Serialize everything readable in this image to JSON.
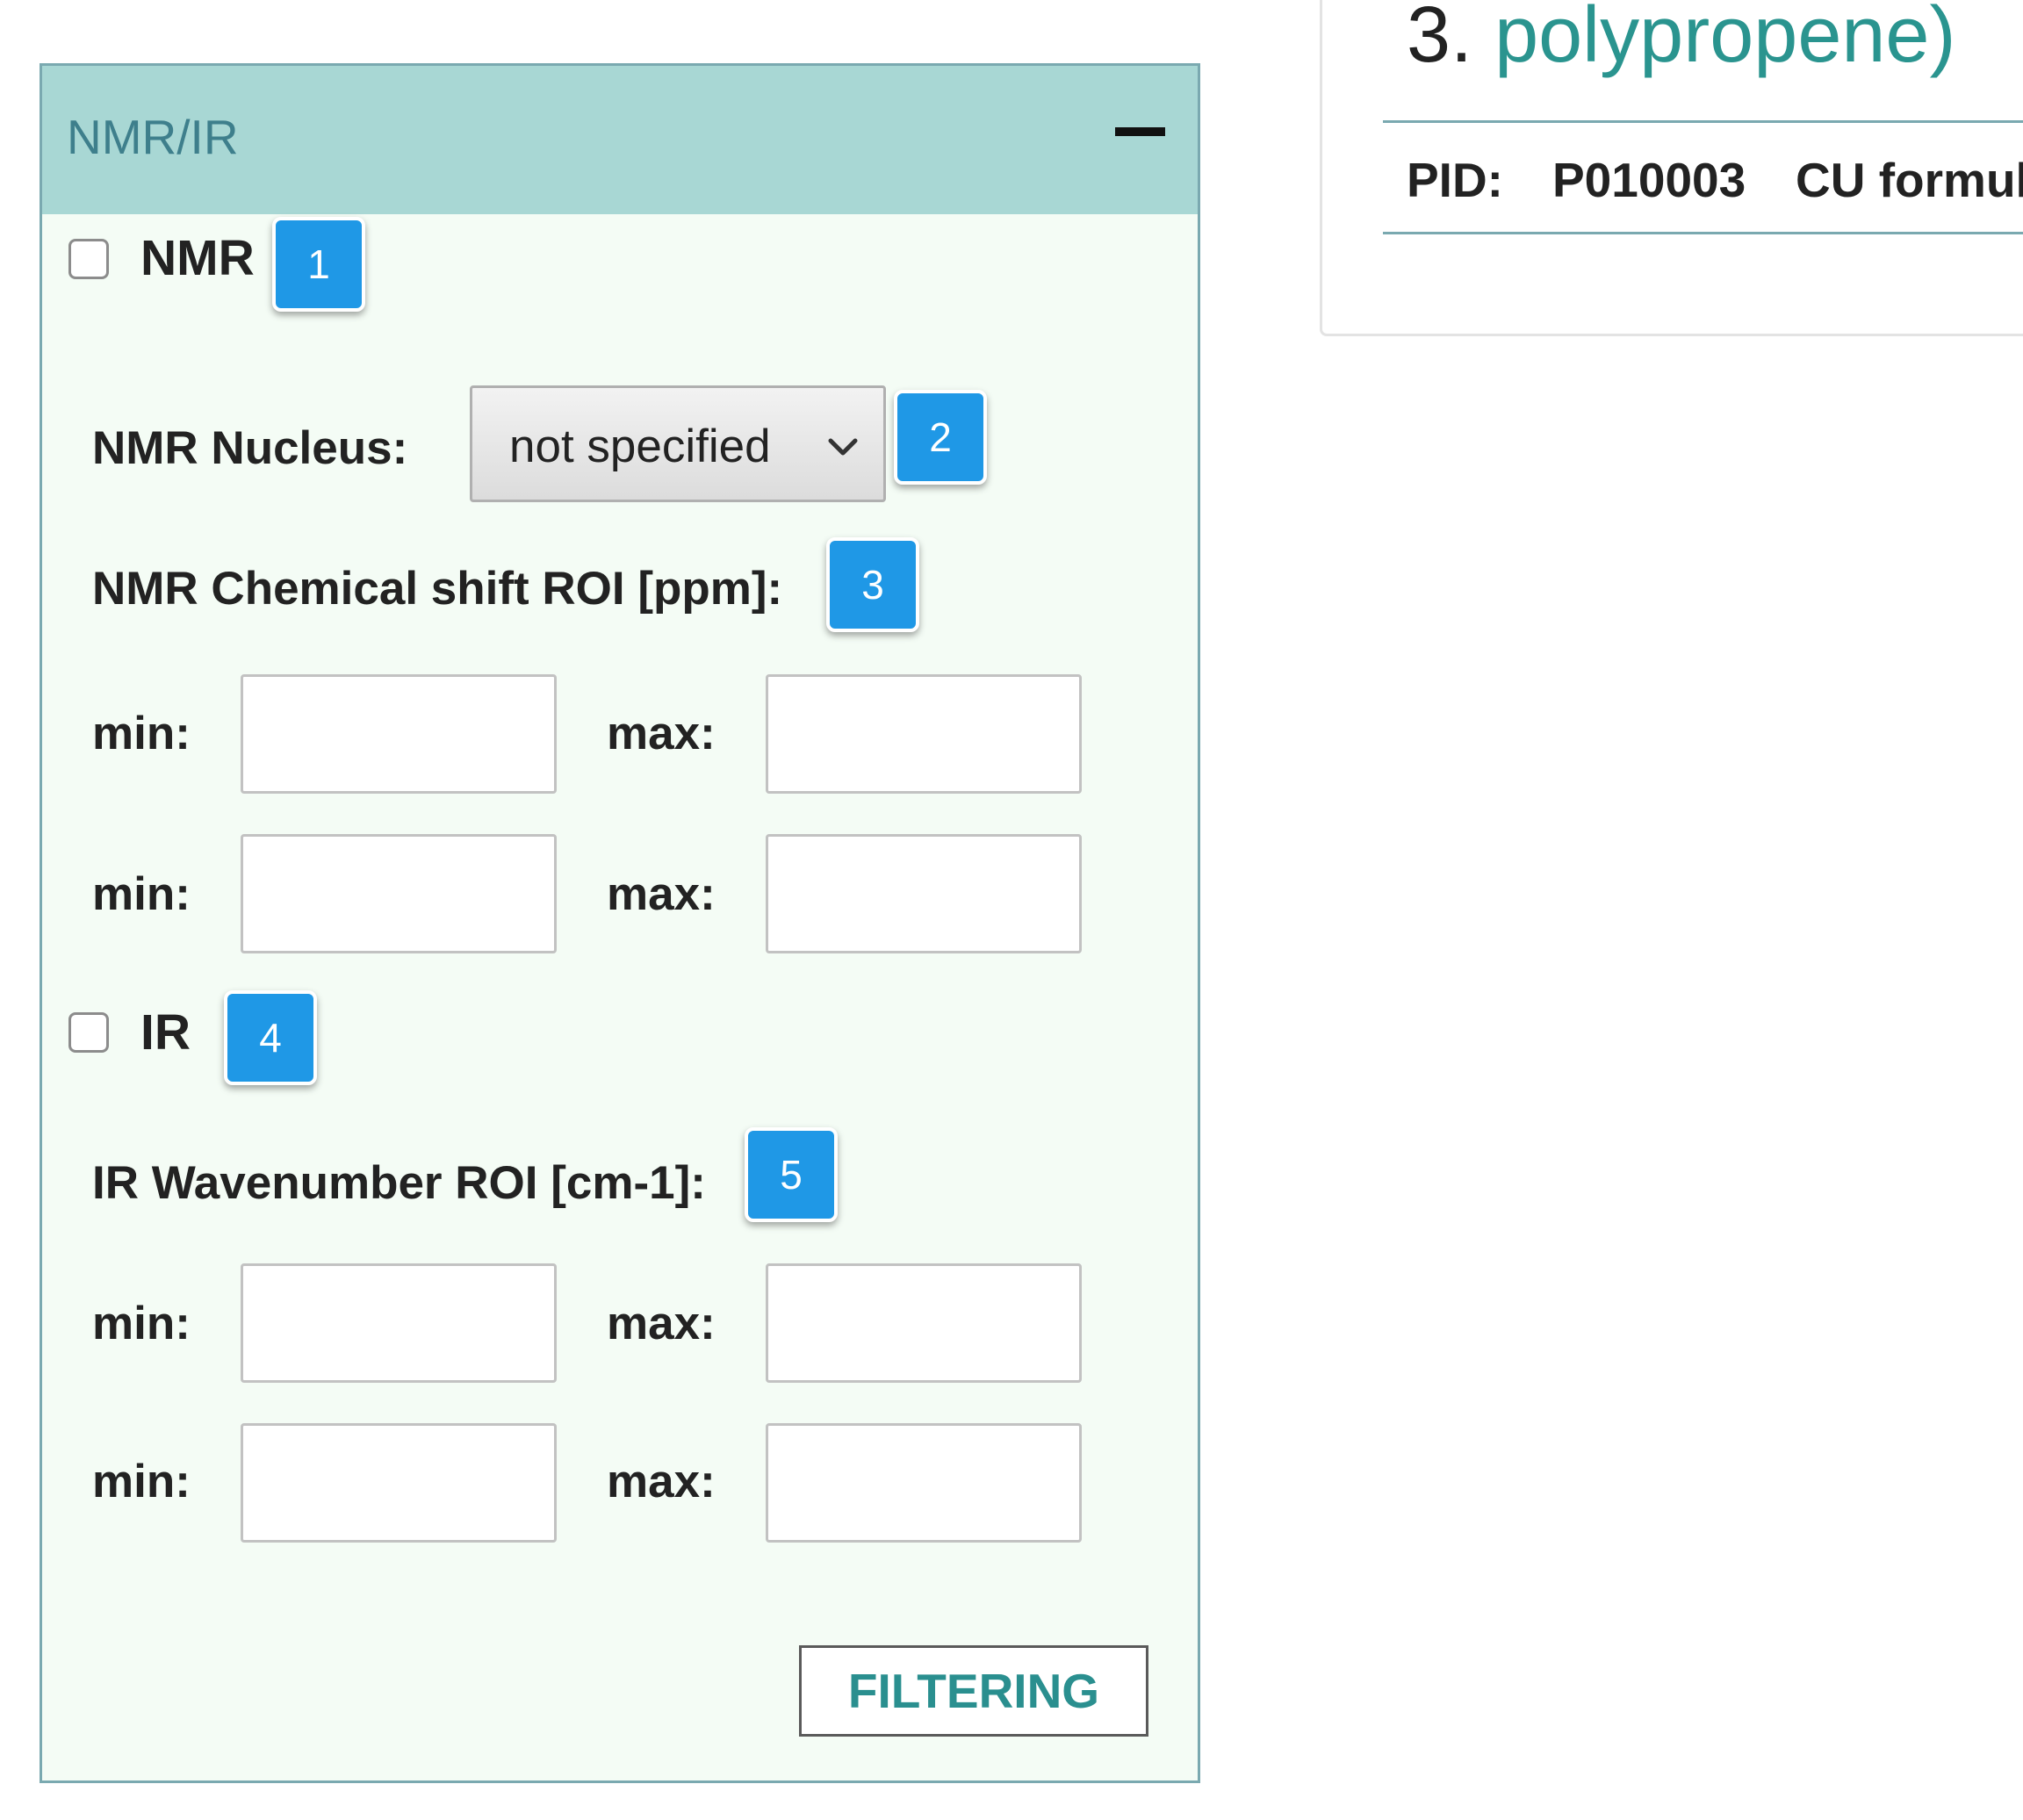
{
  "panel": {
    "title": "NMR/IR",
    "collapse_symbol": "minus-icon"
  },
  "nmr": {
    "checkbox_label": "NMR",
    "nucleus_label": "NMR Nucleus:",
    "nucleus_selected": "not specified",
    "shift_label": "NMR Chemical shift ROI [ppm]:",
    "ranges": [
      {
        "min_label": "min:",
        "max_label": "max:",
        "min_value": "",
        "max_value": ""
      },
      {
        "min_label": "min:",
        "max_label": "max:",
        "min_value": "",
        "max_value": ""
      }
    ]
  },
  "ir": {
    "checkbox_label": "IR",
    "wavenumber_label": "IR Wavenumber ROI [cm-1]:",
    "ranges": [
      {
        "min_label": "min:",
        "max_label": "max:",
        "min_value": "",
        "max_value": ""
      },
      {
        "min_label": "min:",
        "max_label": "max:",
        "min_value": "",
        "max_value": ""
      }
    ]
  },
  "filter_button": "FILTERING",
  "badges": [
    "1",
    "2",
    "3",
    "4",
    "5"
  ],
  "result": {
    "index": "3.",
    "name": "polypropene)",
    "pid_label": "PID:",
    "pid_value": "P010003",
    "cu_label": "CU formul"
  },
  "colors": {
    "header_bg": "#a8d7d4",
    "panel_bg": "#f4fcf5",
    "accent_teal": "#2a948f",
    "badge_blue": "#1f98e6"
  }
}
